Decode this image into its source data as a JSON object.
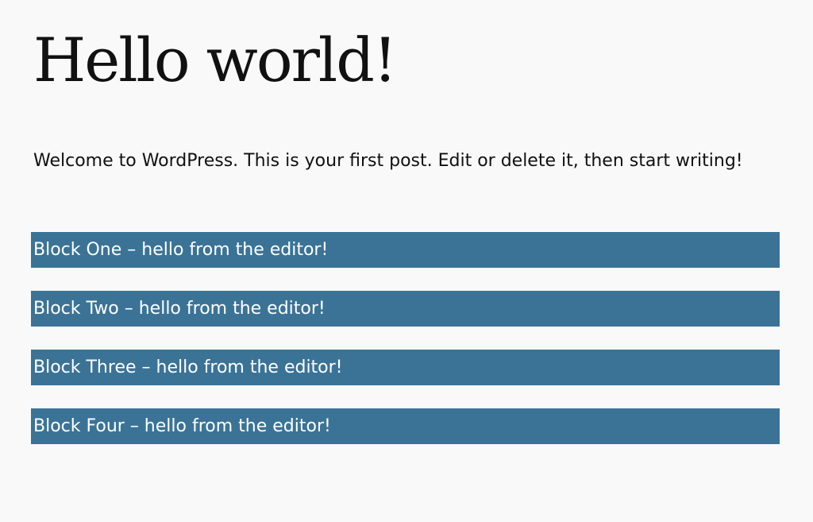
{
  "post": {
    "title": "Hello world!",
    "excerpt": "Welcome to WordPress. This is your first post. Edit or delete it, then start writing!"
  },
  "blocks": [
    {
      "label": "Block One – hello from the editor!"
    },
    {
      "label": "Block Two – hello from the editor!"
    },
    {
      "label": "Block Three – hello from the editor!"
    },
    {
      "label": "Block Four – hello from the editor!"
    }
  ],
  "colors": {
    "background": "#f9f9f9",
    "text": "#111111",
    "block_background": "#3b7397",
    "block_text": "#ffffff"
  }
}
